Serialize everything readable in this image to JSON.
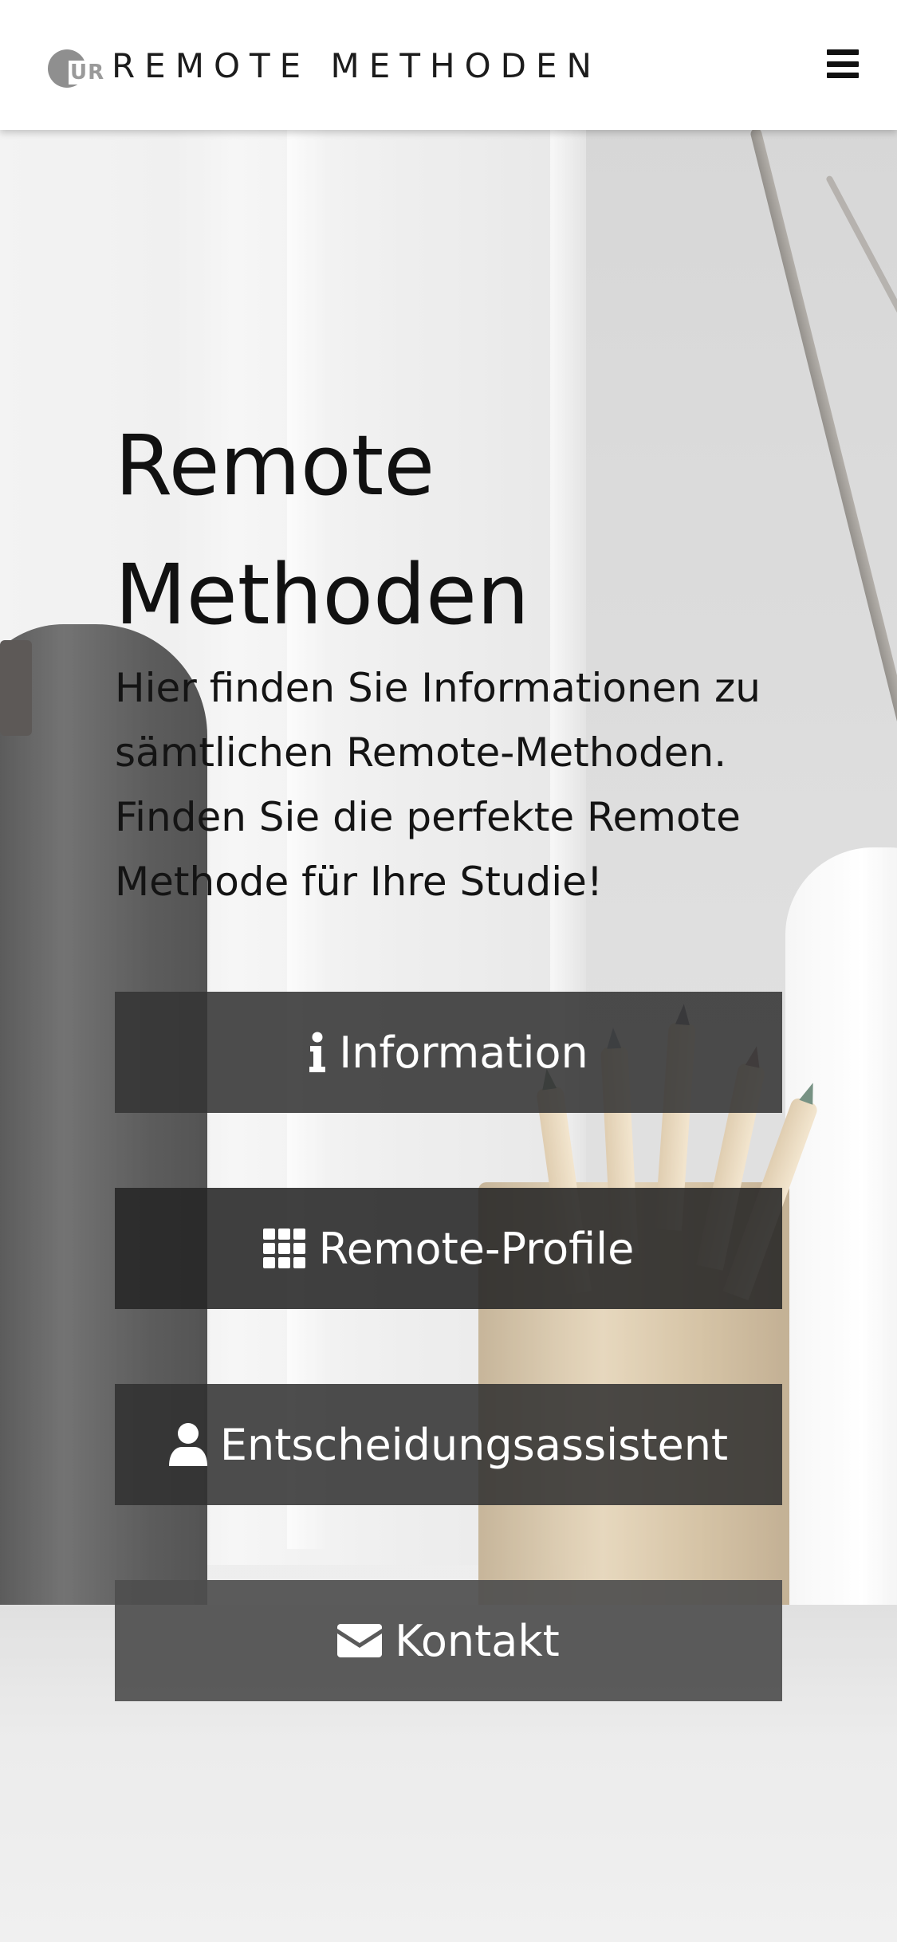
{
  "header": {
    "logo_text": "UR",
    "title": "REMOTE METHODEN",
    "menu_icon": "hamburger-menu-icon"
  },
  "hero": {
    "title_line1": "Remote",
    "title_line2": "Methoden",
    "intro_line1": "Hier finden Sie Informationen zu",
    "intro_line2": "sämtlichen Remote-Methoden.",
    "intro_line3": "Finden Sie die perfekte Remote",
    "intro_line4": "Methode für Ihre Studie!"
  },
  "buttons": [
    {
      "label": "Information",
      "icon": "info-icon"
    },
    {
      "label": "Remote-Profile",
      "icon": "grid-icon"
    },
    {
      "label": "Entscheidungsassistent",
      "icon": "user-icon"
    },
    {
      "label": "Kontakt",
      "icon": "envelope-icon"
    }
  ],
  "colors": {
    "header_bg": "#ffffff",
    "button_bg": "#3a3a3a",
    "button_text": "#ffffff",
    "title_text": "#111111",
    "logo_gray": "#8f8f8f"
  }
}
